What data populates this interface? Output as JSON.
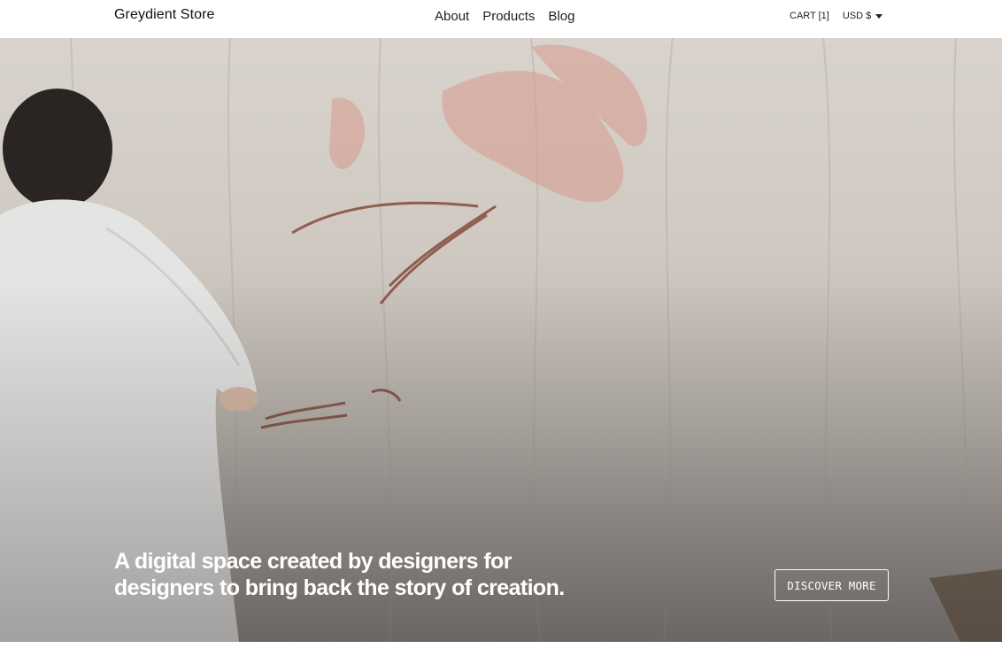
{
  "header": {
    "logo": "Greydient Store",
    "nav": [
      "About",
      "Products",
      "Blog"
    ],
    "cart_label": "CART [1]",
    "currency_label": "USD $"
  },
  "hero": {
    "headline": "A digital space created by designers for designers to bring back the story of creation.",
    "cta_label": "DISCOVER MORE",
    "image_description_icon": "painting-artist-photo"
  },
  "colors": {
    "header_bg": "#ffffff",
    "text": "#111111",
    "hero_text": "#ffffff"
  }
}
